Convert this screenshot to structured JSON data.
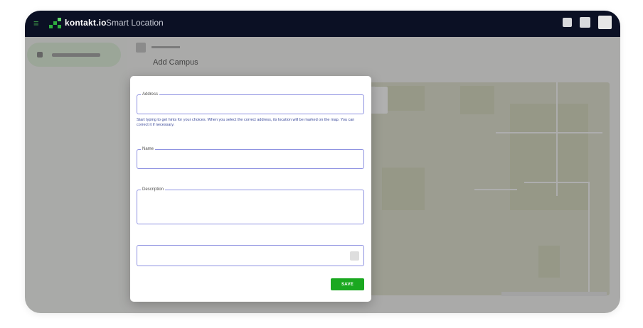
{
  "app": {
    "brand": "kontakt.io",
    "product": "Smart Location",
    "menu_icon": "hamburger-icon",
    "colors": {
      "topbar": "#0b1024",
      "accent": "#1aa820",
      "field_border": "#8d91e1",
      "help_text": "#3c4a9a"
    }
  },
  "page": {
    "title": "Add Campus"
  },
  "form": {
    "address": {
      "label": "Address",
      "value": "",
      "placeholder": ""
    },
    "address_help": "Start typing to get hints for your choices. When you select the correct address, its location will be marked on the map. You can correct it if necessary.",
    "name": {
      "label": "Name",
      "value": "",
      "placeholder": ""
    },
    "description": {
      "label": "Description",
      "value": "",
      "placeholder": ""
    },
    "extra": {
      "value": "",
      "placeholder": ""
    },
    "save_label": "SAVE"
  }
}
